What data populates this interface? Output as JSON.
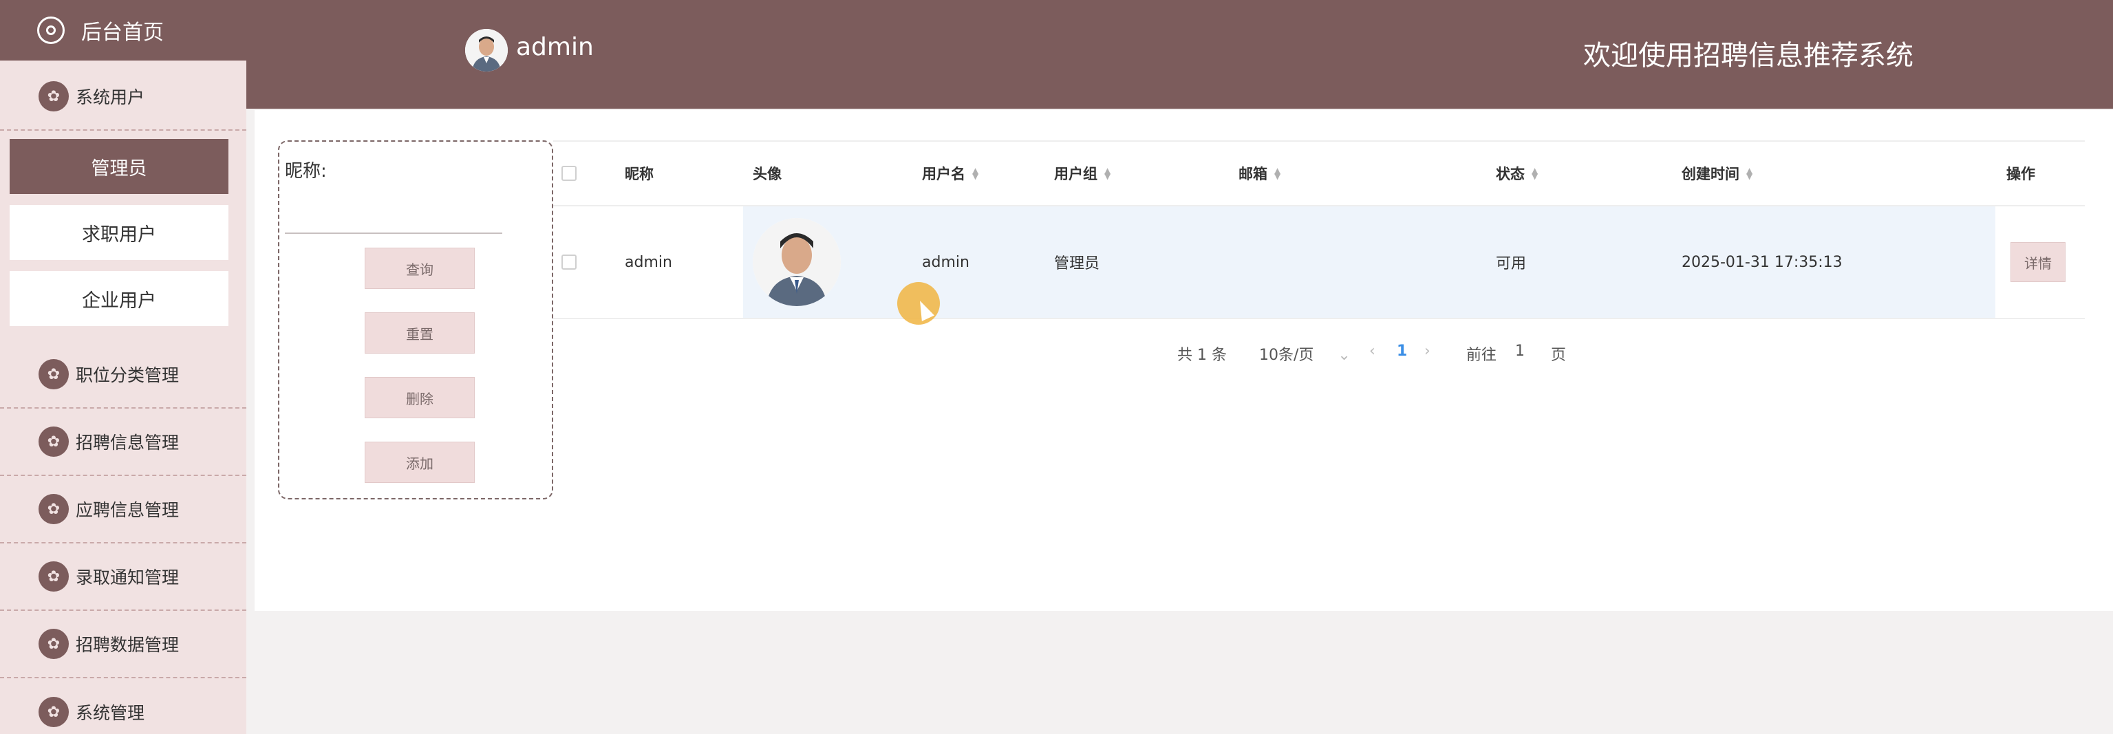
{
  "sidebar": {
    "home": "后台首页",
    "items": [
      {
        "label": "系统用户"
      },
      {
        "label": "职位分类管理"
      },
      {
        "label": "招聘信息管理"
      },
      {
        "label": "应聘信息管理"
      },
      {
        "label": "录取通知管理"
      },
      {
        "label": "招聘数据管理"
      },
      {
        "label": "系统管理"
      }
    ],
    "sub_items": [
      {
        "label": "管理员",
        "active": true
      },
      {
        "label": "求职用户",
        "active": false
      },
      {
        "label": "企业用户",
        "active": false
      }
    ]
  },
  "header": {
    "user": "admin",
    "welcome": "欢迎使用招聘信息推荐系统"
  },
  "search": {
    "label": "昵称:",
    "placeholder": "",
    "buttons": [
      "查询",
      "重置",
      "删除",
      "添加"
    ]
  },
  "table": {
    "columns": [
      "昵称",
      "头像",
      "用户名",
      "用户组",
      "邮箱",
      "状态",
      "创建时间",
      "操作"
    ],
    "rows": [
      {
        "nickname": "admin",
        "username": "admin",
        "group": "管理员",
        "email": "",
        "status": "可用",
        "created": "2025-01-31 17:35:13",
        "action": "详情"
      }
    ]
  },
  "pagination": {
    "total": "共 1 条",
    "page_size": "10条/页",
    "current": "1",
    "goto_prefix": "前往",
    "goto_value": "1",
    "goto_suffix": "页"
  },
  "colors": {
    "primary": "#7c5c5c",
    "sidebar_bg": "#f1e2e2",
    "button_bg": "#f0dcdc",
    "row_highlight": "#eef4fb",
    "link": "#3a8ee6"
  }
}
